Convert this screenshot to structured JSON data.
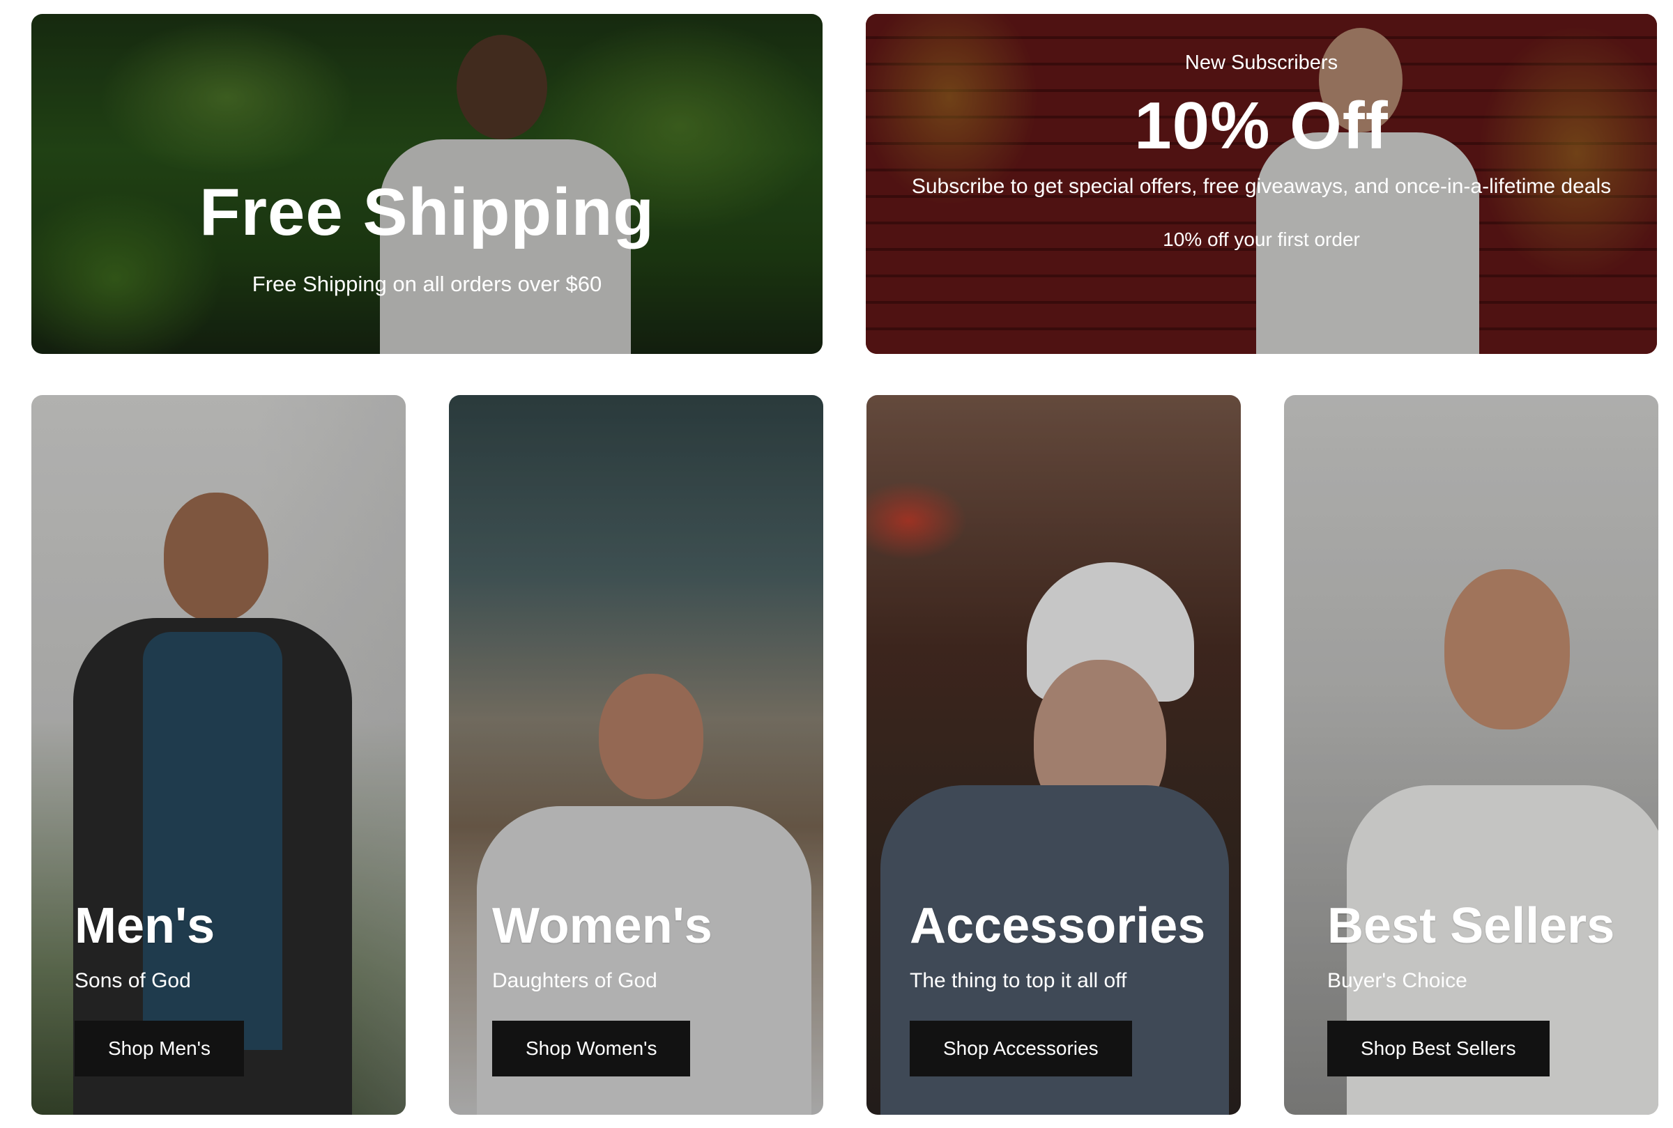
{
  "promos": [
    {
      "title": "Free Shipping",
      "subtitle": "Free Shipping on all orders over $60"
    },
    {
      "kicker": "New Subscribers",
      "title": "10% Off",
      "subtitle": "Subscribe to get special offers, free giveaways, and once-in-a-lifetime deals",
      "note": "10% off your first order"
    }
  ],
  "collections": [
    {
      "title": "Men's",
      "subtitle": "Sons of God",
      "button": "Shop Men's"
    },
    {
      "title": "Women's",
      "subtitle": "Daughters of God",
      "button": "Shop Women's"
    },
    {
      "title": "Accessories",
      "subtitle": "The thing to top it all off",
      "button": "Shop Accessories"
    },
    {
      "title": "Best Sellers",
      "subtitle": "Buyer's Choice",
      "button": "Shop Best Sellers"
    }
  ],
  "colors": {
    "button_bg": "#121212",
    "text": "#ffffff"
  }
}
